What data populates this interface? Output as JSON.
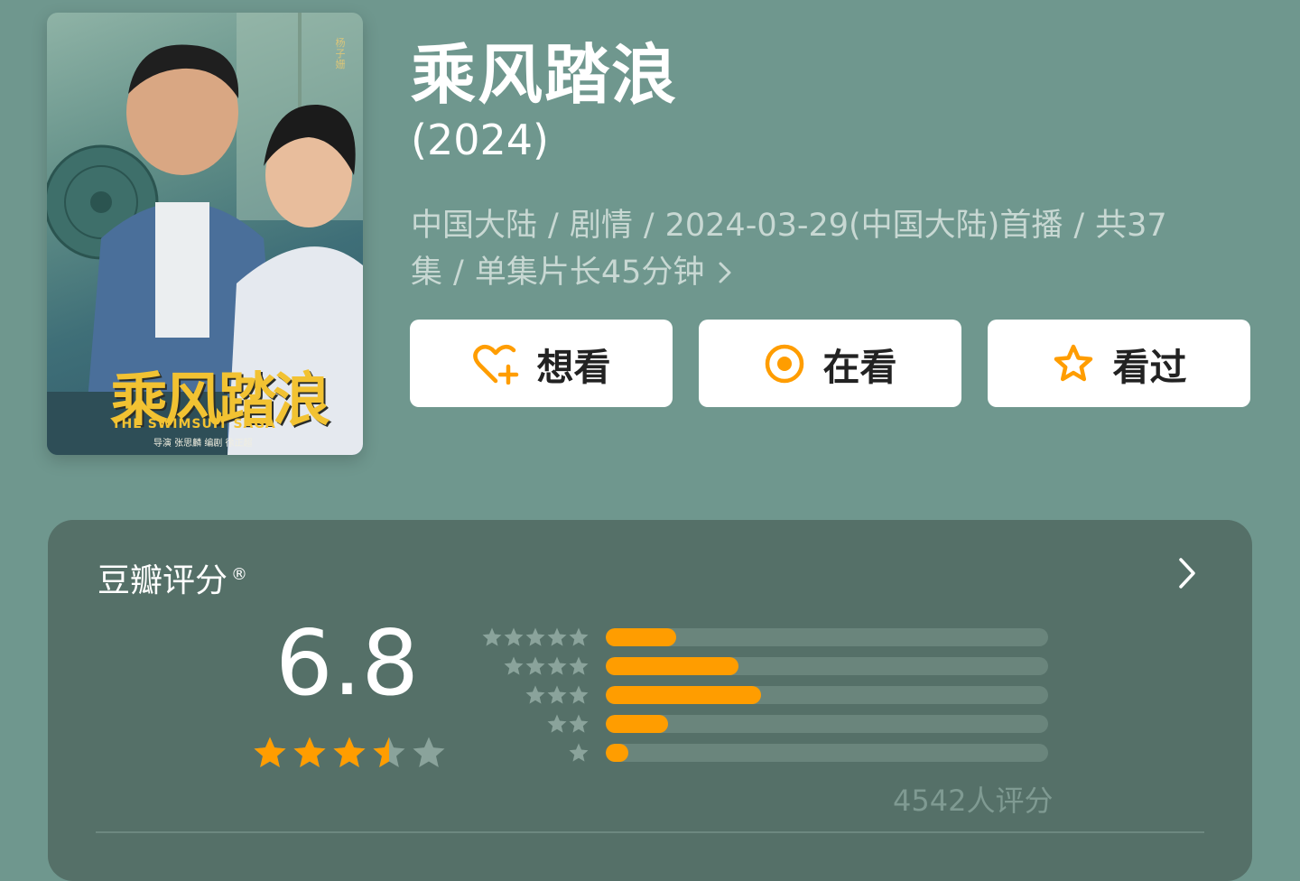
{
  "poster": {
    "title": "乘风踏浪",
    "subtitle": "THE SWIMSUIT SAGA",
    "credit": "导演 张思麟   编剧 徐正超",
    "side_text": "杨子姗"
  },
  "title": "乘风踏浪",
  "year": "(2024)",
  "meta": {
    "region": "中国大陆",
    "genre": "剧情",
    "premiere": "2024-03-29(中国大陆)首播",
    "episodes": "共37集",
    "duration": "单集片长45分钟",
    "separator": "/"
  },
  "buttons": [
    {
      "label": "想看",
      "icon": "heart-plus-icon"
    },
    {
      "label": "在看",
      "icon": "target-circle-icon"
    },
    {
      "label": "看过",
      "icon": "star-outline-icon"
    }
  ],
  "rating": {
    "label": "豆瓣评分",
    "registered_mark": "®",
    "score": "6.8",
    "stars": 3.5,
    "distribution": [
      {
        "stars": 5,
        "fraction": 0.16
      },
      {
        "stars": 4,
        "fraction": 0.3
      },
      {
        "stars": 3,
        "fraction": 0.35
      },
      {
        "stars": 2,
        "fraction": 0.14
      },
      {
        "stars": 1,
        "fraction": 0.05
      }
    ],
    "count_text": "4542人评分"
  },
  "colors": {
    "background": "#6f978e",
    "card": "#557068",
    "accent": "#ff9d00",
    "star_empty": "#8aa39b"
  }
}
